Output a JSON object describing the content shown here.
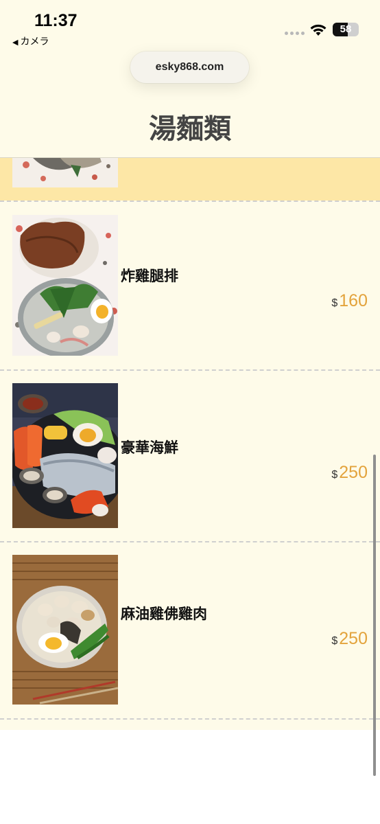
{
  "status_bar": {
    "time": "11:37",
    "back_app": "カメラ",
    "battery_percent": "58",
    "battery_level": 0.58
  },
  "browser": {
    "url": "esky868.com"
  },
  "page": {
    "title": "湯麵類"
  },
  "menu_items": [
    {
      "name": "炸雞腿排",
      "currency": "$",
      "price": "160"
    },
    {
      "name": "豪華海鮮",
      "currency": "$",
      "price": "250"
    },
    {
      "name": "麻油雞佛雞肉",
      "currency": "$",
      "price": "250"
    }
  ],
  "colors": {
    "background": "#fefbe9",
    "highlight_row": "#fde7a6",
    "price": "#e3a33c",
    "title": "#444444"
  },
  "icons": [
    "back-triangle-icon",
    "signal-dots-icon",
    "wifi-icon",
    "battery-icon"
  ]
}
